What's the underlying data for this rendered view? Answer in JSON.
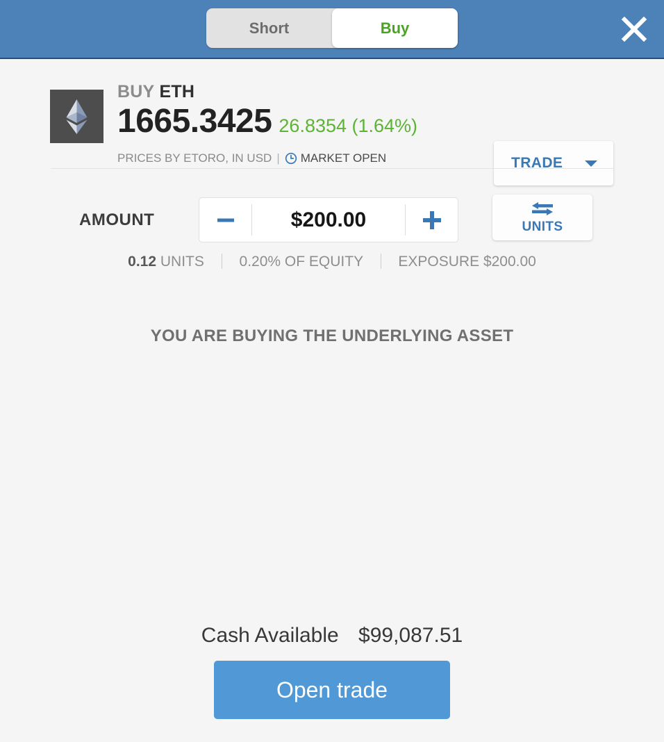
{
  "top_bar": {
    "toggle": {
      "short_label": "Short",
      "buy_label": "Buy",
      "selected": "Buy"
    },
    "close_label": "close-icon",
    "background_color": "#4d82b8"
  },
  "instrument": {
    "direction_label": "BUY",
    "symbol": "ETH",
    "price": "1665.3425",
    "change": "26.8354 (1.64%)",
    "change_color": "#5cb335",
    "prices_by": "PRICES BY ETORO, IN USD",
    "separator": "|",
    "market_status": "MARKET OPEN",
    "logo_name": "ethereum-logo"
  },
  "trade_dropdown": {
    "label": "TRADE",
    "accent_color": "#3a78b5"
  },
  "amount": {
    "label": "AMOUNT",
    "value": "$200.00",
    "minus_label": "−",
    "plus_label": "+"
  },
  "units_toggle": {
    "label": "UNITS",
    "accent_color": "#3a78b5"
  },
  "stats": {
    "units_value": "0.12",
    "units_label": "UNITS",
    "equity_text": "0.20% OF EQUITY",
    "exposure_text": "EXPOSURE $200.00"
  },
  "notice": {
    "text": "YOU ARE BUYING THE UNDERLYING ASSET"
  },
  "footer": {
    "cash_available_label": "Cash Available",
    "cash_available_value": "$99,087.51",
    "open_trade_label": "Open trade",
    "open_trade_color": "#5098d6"
  }
}
